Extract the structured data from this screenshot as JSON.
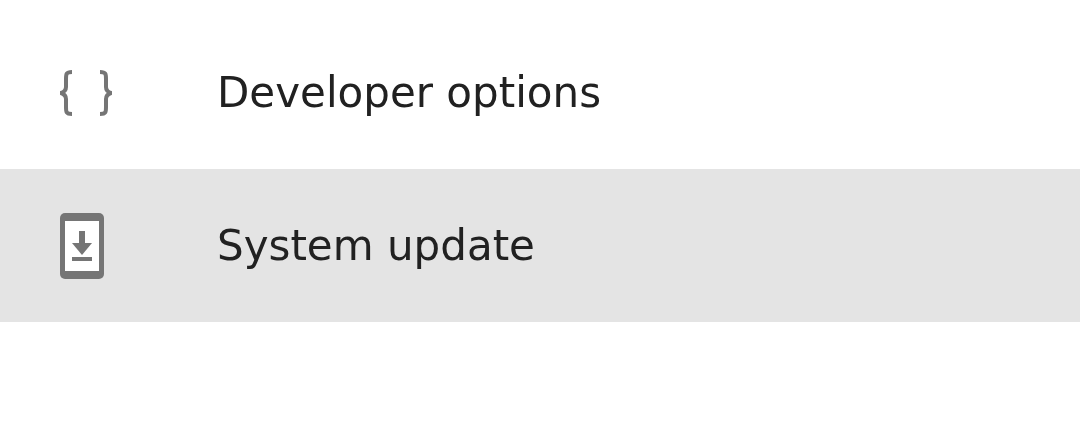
{
  "settings_items": [
    {
      "label": "Developer options",
      "kind": "developer",
      "selected": false
    },
    {
      "label": "System update",
      "kind": "update",
      "selected": true
    }
  ]
}
